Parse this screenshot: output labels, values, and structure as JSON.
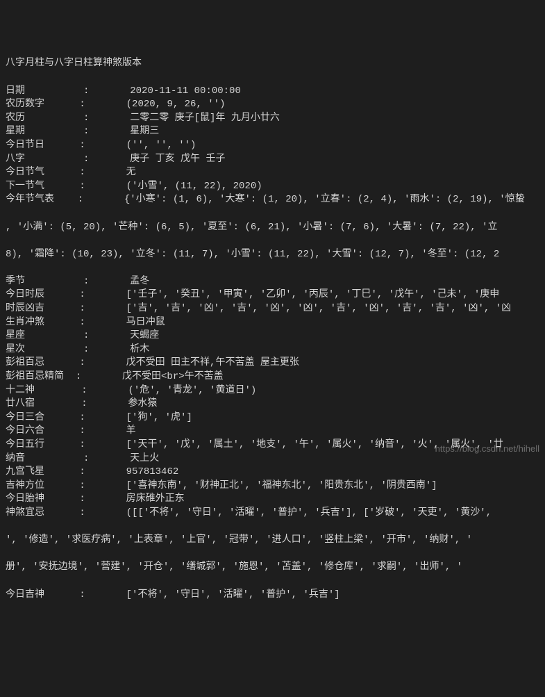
{
  "title": "八字月柱与八字日柱算神煞版本",
  "rows": [
    {
      "label": "日期",
      "colon": ":",
      "value": "2020-11-11 00:00:00"
    },
    {
      "label": "农历数字",
      "colon": ":",
      "value": "(2020, 9, 26, '')"
    },
    {
      "label": "农历",
      "colon": ":",
      "value": "二零二零 庚子[鼠]年 九月小廿六"
    },
    {
      "label": "星期",
      "colon": ":",
      "value": "星期三"
    },
    {
      "label": "今日节日",
      "colon": ":",
      "value": "('', '', '')"
    },
    {
      "label": "八字",
      "colon": ":",
      "value": "庚子 丁亥 戊午 壬子"
    },
    {
      "label": "今日节气",
      "colon": ":",
      "value": "无"
    },
    {
      "label": "下一节气",
      "colon": ":",
      "value": "('小雪', (11, 22), 2020)"
    },
    {
      "label": "今年节气表",
      "colon": ":",
      "value": "{'小寒': (1, 6), '大寒': (1, 20), '立春': (2, 4), '雨水': (2, 19), '惊蛰"
    }
  ],
  "wrap1": ", '小满': (5, 20), '芒种': (6, 5), '夏至': (6, 21), '小暑': (7, 6), '大暑': (7, 22), '立",
  "wrap2": "8), '霜降': (10, 23), '立冬': (11, 7), '小雪': (11, 22), '大雪': (12, 7), '冬至': (12, 2",
  "rows2": [
    {
      "label": "季节",
      "colon": ":",
      "value": "孟冬"
    },
    {
      "label": "今日时辰",
      "colon": ":",
      "value": "['壬子', '癸丑', '甲寅', '乙卯', '丙辰', '丁巳', '戊午', '己未', '庚申"
    },
    {
      "label": "时辰凶吉",
      "colon": ":",
      "value": "['吉', '吉', '凶', '吉', '凶', '凶', '吉', '凶', '吉', '吉', '凶', '凶"
    },
    {
      "label": "生肖冲煞",
      "colon": ":",
      "value": "马日冲鼠"
    },
    {
      "label": "星座",
      "colon": ":",
      "value": "天蝎座"
    },
    {
      "label": "星次",
      "colon": ":",
      "value": "析木"
    },
    {
      "label": "彭祖百忌",
      "colon": ":",
      "value": "戊不受田 田主不祥,午不苦盖 屋主更张"
    },
    {
      "label": "彭祖百忌精简",
      "colon": ":",
      "value": "戊不受田<br>午不苦盖"
    },
    {
      "label": "十二神",
      "colon": ":",
      "value": "('危', '青龙', '黄道日')"
    },
    {
      "label": "廿八宿",
      "colon": ":",
      "value": "参水猿"
    },
    {
      "label": "今日三合",
      "colon": ":",
      "value": "['狗', '虎']"
    },
    {
      "label": "今日六合",
      "colon": ":",
      "value": "羊"
    },
    {
      "label": "今日五行",
      "colon": ":",
      "value": "['天干', '戊', '属土', '地支', '午', '属火', '纳音', '火', '属火', '廿"
    },
    {
      "label": "纳音",
      "colon": ":",
      "value": "天上火"
    },
    {
      "label": "九宫飞星",
      "colon": ":",
      "value": "957813462"
    },
    {
      "label": "吉神方位",
      "colon": ":",
      "value": "['喜神东南', '财神正北', '福神东北', '阳贵东北', '阴贵西南']"
    },
    {
      "label": "今日胎神",
      "colon": ":",
      "value": "房床碓外正东"
    },
    {
      "label": "神煞宜忌",
      "colon": ":",
      "value": "([['不将', '守日', '活曜', '普护', '兵吉'], ['岁破', '天吏', '黄沙',"
    }
  ],
  "wrap3": "', '修造', '求医疗病', '上表章', '上官', '冠带', '进人口', '竖柱上梁', '开市', '纳财', '",
  "wrap4": "册', '安抚边境', '营建', '开仓', '缮城郭', '施恩', '苫盖', '修仓库', '求嗣', '出师', '",
  "rows3": [
    {
      "label": "今日吉神",
      "colon": ":",
      "value": "['不将', '守日', '活曜', '普护', '兵吉']"
    }
  ],
  "watermark": "https://blog.csdn.net/hihell"
}
